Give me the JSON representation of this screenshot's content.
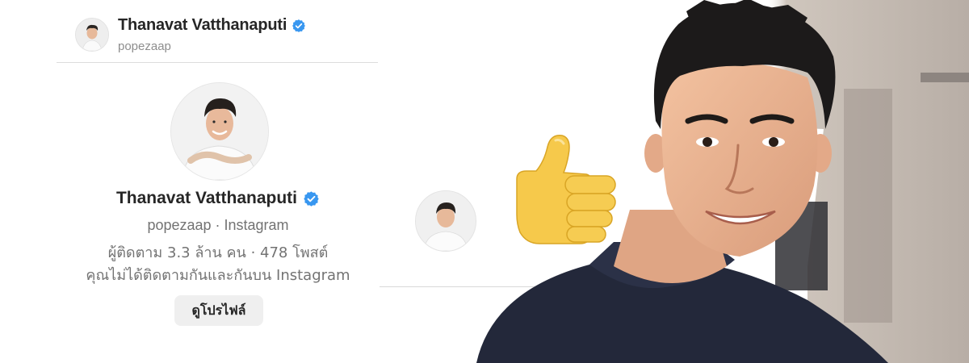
{
  "header": {
    "name": "Thanavat Vatthanaputi",
    "handle": "popezaap"
  },
  "profile_card": {
    "name": "Thanavat Vatthanaputi",
    "subline": "popezaap · Instagram",
    "stats": "ผู้ติดตาม 3.3 ล้าน คน · 478 โพสต์",
    "note": "คุณไม่ได้ติดตามกันและกันบน Instagram",
    "view_profile_label": "ดูโปรไฟล์"
  },
  "chat": {
    "reaction_icon": "thumbs-up-icon"
  },
  "colors": {
    "verified_blue": "#3897f0",
    "thumb_yellow": "#f6c94b"
  }
}
